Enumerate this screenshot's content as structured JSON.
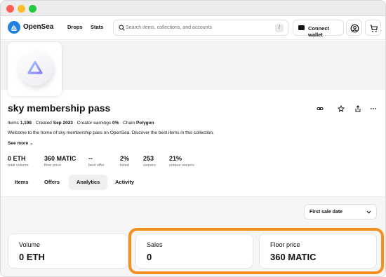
{
  "nav": {
    "brand": "OpenSea",
    "links": [
      "Drops",
      "Stats"
    ],
    "search_placeholder": "Search items, collections, and accounts",
    "search_shortcut": "/",
    "connect_label": "Connect wallet"
  },
  "collection": {
    "title": "sky membership pass",
    "meta": {
      "items_label": "Items",
      "items_value": "1,198",
      "created_label": "Created",
      "created_value": "Sep 2023",
      "earnings_label": "Creator earnings",
      "earnings_value": "0%",
      "chain_label": "Chain",
      "chain_value": "Polygon",
      "separator": "·"
    },
    "description": "Welcome to the home of sky membership pass on OpenSea. Discover the best items in this collection.",
    "see_more": "See more ⌄",
    "stats": [
      {
        "value": "0 ETH",
        "label": "total volume"
      },
      {
        "value": "360 MATIC",
        "label": "floor price"
      },
      {
        "value": "--",
        "label": "best offer"
      },
      {
        "value": "2%",
        "label": "listed"
      },
      {
        "value": "253",
        "label": "owners"
      },
      {
        "value": "21%",
        "label": "unique owners"
      }
    ]
  },
  "tabs": [
    "Items",
    "Offers",
    "Analytics",
    "Activity"
  ],
  "active_tab": "Analytics",
  "analytics": {
    "date_filter": "First sale date",
    "cards": [
      {
        "title": "Volume",
        "value": "0 ETH"
      },
      {
        "title": "Sales",
        "value": "0"
      },
      {
        "title": "Floor price",
        "value": "360 MATIC"
      }
    ]
  },
  "colors": {
    "accent": "#2081e2",
    "highlight": "#f5901e"
  }
}
